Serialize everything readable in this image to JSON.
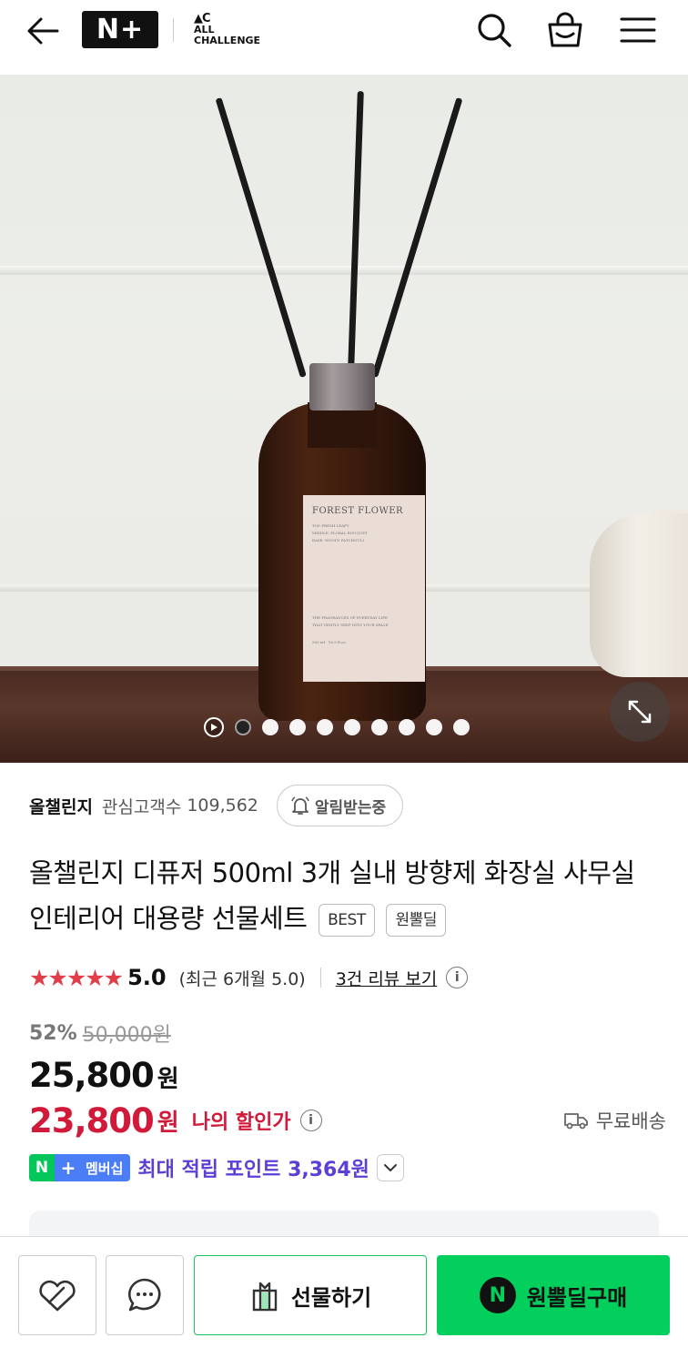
{
  "header": {
    "brand_logo": "N+",
    "store_logo_mark": "▲C",
    "store_logo_line1": "ALL",
    "store_logo_line2": "CHALLENGE",
    "icons": [
      "back-arrow-icon",
      "search-icon",
      "cart-icon",
      "menu-icon"
    ]
  },
  "product_image": {
    "label_title": "FOREST FLOWER",
    "label_notes": [
      "TOP. FRESH LEAFY",
      "MIDDLE. FLORAL BOUQUET",
      "BASE. WOODY PATCHOULI"
    ],
    "label_tagline": [
      "THE FRAGRANCES OF EVERYDAY LIFE",
      "THAT GENTLY SEEP INTO YOUR SPACE"
    ],
    "label_volume": "500 ml · 16.9 fl.oz.",
    "slide_count": 9,
    "active_slide": 1
  },
  "store": {
    "name": "올챌린지",
    "fans_label": "관심고객수",
    "fans_count": "109,562",
    "notify_label": "알림받는중"
  },
  "product": {
    "title": "올챌린지 디퓨저 500ml 3개 실내 방향제 화장실 사무실 인테리어 대용량 선물세트",
    "tags": [
      "BEST",
      "원뿔딜"
    ]
  },
  "rating": {
    "stars": "★★★★★",
    "score": "5.0",
    "recent": "(최근 6개월 5.0)",
    "review_link": "3건 리뷰 보기",
    "info": "i"
  },
  "price": {
    "discount": "52%",
    "original": "50,000원",
    "sale": "25,800",
    "won": "원",
    "my_price": "23,800",
    "my_won": "원",
    "my_label": "나의 할인가",
    "shipping": "무료배송"
  },
  "membership": {
    "n": "N",
    "plus": "+",
    "label": "멤버십",
    "points": "최대 적립 포인트 3,364원"
  },
  "bottom_bar": {
    "gift_label": "선물하기",
    "buy_label": "원뿔딜구매",
    "buy_badge": "N"
  },
  "colors": {
    "accent_red": "#d1193a",
    "star_red": "#e13e4a",
    "naver_green": "#03cf5d",
    "membership_blue": "#4b7ef6",
    "points_purple": "#5b3fd6"
  }
}
